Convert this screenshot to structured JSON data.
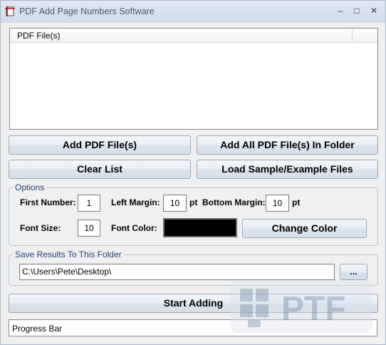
{
  "window": {
    "title": "PDF Add Page Numbers Software",
    "minimize_glyph": "–",
    "maximize_glyph": "□",
    "close_glyph": "✕"
  },
  "file_list": {
    "column_header": "PDF File(s)",
    "items": []
  },
  "buttons": {
    "add_files": "Add PDF File(s)",
    "add_folder": "Add All PDF File(s) In Folder",
    "clear_list": "Clear List",
    "load_sample": "Load Sample/Example Files",
    "change_color": "Change Color",
    "browse": "...",
    "start": "Start Adding"
  },
  "options": {
    "title": "Options",
    "first_number_label": "First Number:",
    "first_number": "1",
    "left_margin_label": "Left Margin:",
    "left_margin": "10",
    "left_margin_unit": "pt",
    "bottom_margin_label": "Bottom Margin:",
    "bottom_margin": "10",
    "bottom_margin_unit": "pt",
    "font_size_label": "Font Size:",
    "font_size": "10",
    "font_color_label": "Font Color:",
    "font_color": "#000000"
  },
  "save": {
    "title": "Save Results To This Folder",
    "path": "C:\\Users\\Pete\\Desktop\\"
  },
  "progress": {
    "label": "Progress Bar",
    "value": 0
  },
  "watermark": {
    "text": "PTF",
    "color": "#8aa0b8"
  },
  "colors": {
    "group_title": "#1f3f7a",
    "title_text": "#4a5a6a"
  }
}
